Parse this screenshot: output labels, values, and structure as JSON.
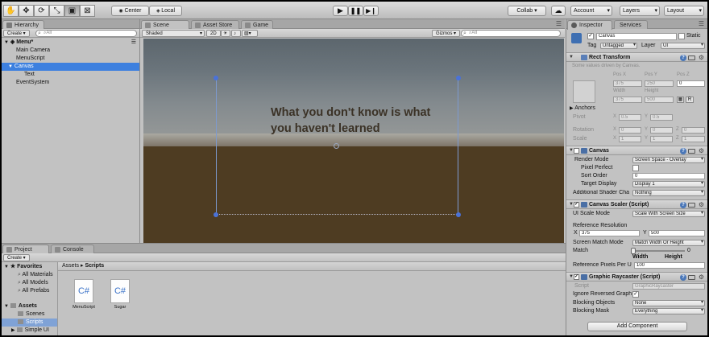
{
  "toolbar": {
    "center_label": "Center",
    "local_label": "Local",
    "collab_label": "Collab",
    "account_label": "Account",
    "layers_label": "Layers",
    "layout_label": "Layout"
  },
  "hierarchy": {
    "tab": "Hierarchy",
    "create": "Create",
    "search_placeholder": "⌕All",
    "scene_name": "Menu*",
    "items": [
      "Main Camera",
      "MenuScript",
      "Canvas",
      "Text",
      "EventSystem"
    ]
  },
  "scene": {
    "tabs": [
      "Scene",
      "Asset Store",
      "Game"
    ],
    "shading": "Shaded",
    "mode2d": "2D",
    "gizmos": "Gizmos",
    "search_placeholder": "⌕All",
    "text_line1": "What you don't know is what",
    "text_line2": "you haven't learned",
    "colors": {
      "sky": "#6f7a82",
      "ground": "#4e3c22",
      "text": "#3b3226",
      "rect_handle": "#4a72d8"
    }
  },
  "project": {
    "tabs": [
      "Project",
      "Console"
    ],
    "create": "Create",
    "favorites_label": "Favorites",
    "favorites": [
      "All Materials",
      "All Models",
      "All Prefabs"
    ],
    "assets_label": "Assets",
    "assets_children": [
      "Scenes",
      "Scripts",
      "Simple UI"
    ],
    "breadcrumb_root": "Assets",
    "breadcrumb_sep": "▸",
    "breadcrumb_current": "Scripts",
    "files": [
      {
        "name": "MenuScript",
        "glyph": "C#"
      },
      {
        "name": "Sugar",
        "glyph": "C#"
      }
    ]
  },
  "inspector": {
    "tabs": [
      "Inspector",
      "Services"
    ],
    "object_name": "Canvas",
    "static_label": "Static",
    "tag_label": "Tag",
    "tag_value": "Untagged",
    "layer_label": "Layer",
    "layer_value": "UI",
    "rect_transform": {
      "title": "Rect Transform",
      "note": "Some values driven by Canvas.",
      "pos_x": "Pos X",
      "pos_y": "Pos Y",
      "pos_z": "Pos Z",
      "pos_x_val": "375",
      "pos_y_val": "250",
      "pos_z_val": "0",
      "width_label": "Width",
      "height_label": "Height",
      "width_val": "375",
      "height_val": "500",
      "anchors": "Anchors",
      "pivot": "Pivot",
      "pivot_x": "0.5",
      "pivot_y": "0.5",
      "rotation": "Rotation",
      "rot_x": "0",
      "rot_y": "0",
      "rot_z": "0",
      "scale": "Scale",
      "scale_x": "1",
      "scale_y": "1",
      "scale_z": "1",
      "r_btn": "R"
    },
    "canvas": {
      "title": "Canvas",
      "render_mode_label": "Render Mode",
      "render_mode": "Screen Space - Overlay",
      "pixel_perfect": "Pixel Perfect",
      "sort_order_label": "Sort Order",
      "sort_order": "0",
      "target_display_label": "Target Display",
      "target_display": "Display 1",
      "shader_label": "Additional Shader Cha",
      "shader_value": "Nothing"
    },
    "canvas_scaler": {
      "title": "Canvas Scaler (Script)",
      "scale_mode_label": "UI Scale Mode",
      "scale_mode": "Scale With Screen Size",
      "ref_res_label": "Reference Resolution",
      "x_label": "X",
      "x_val": "375",
      "y_label": "Y",
      "y_val": "500",
      "match_mode_label": "Screen Match Mode",
      "match_mode": "Match Width Or Height",
      "match_label": "Match",
      "match_val": "0",
      "match_level": 0,
      "width_label": "Width",
      "height_label": "Height",
      "ppu_label": "Reference Pixels Per U",
      "ppu_val": "100"
    },
    "raycaster": {
      "title": "Graphic Raycaster (Script)",
      "script_label": "Script",
      "script_val": "GraphicRaycaster",
      "ignore_label": "Ignore Reversed Graph",
      "blocking_objects_label": "Blocking Objects",
      "blocking_objects": "None",
      "blocking_mask_label": "Blocking Mask",
      "blocking_mask": "Everything"
    },
    "add_component": "Add Component"
  }
}
